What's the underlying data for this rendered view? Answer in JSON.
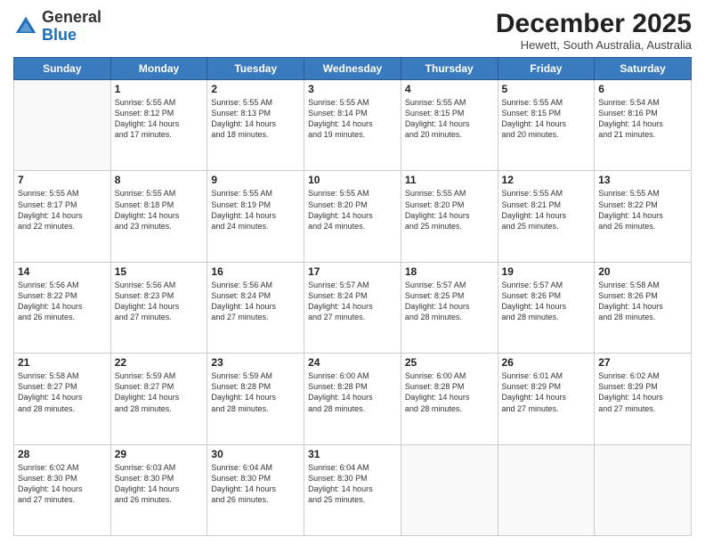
{
  "logo": {
    "general": "General",
    "blue": "Blue"
  },
  "header": {
    "month": "December 2025",
    "location": "Hewett, South Australia, Australia"
  },
  "weekdays": [
    "Sunday",
    "Monday",
    "Tuesday",
    "Wednesday",
    "Thursday",
    "Friday",
    "Saturday"
  ],
  "weeks": [
    [
      {
        "day": "",
        "info": ""
      },
      {
        "day": "1",
        "info": "Sunrise: 5:55 AM\nSunset: 8:12 PM\nDaylight: 14 hours\nand 17 minutes."
      },
      {
        "day": "2",
        "info": "Sunrise: 5:55 AM\nSunset: 8:13 PM\nDaylight: 14 hours\nand 18 minutes."
      },
      {
        "day": "3",
        "info": "Sunrise: 5:55 AM\nSunset: 8:14 PM\nDaylight: 14 hours\nand 19 minutes."
      },
      {
        "day": "4",
        "info": "Sunrise: 5:55 AM\nSunset: 8:15 PM\nDaylight: 14 hours\nand 20 minutes."
      },
      {
        "day": "5",
        "info": "Sunrise: 5:55 AM\nSunset: 8:15 PM\nDaylight: 14 hours\nand 20 minutes."
      },
      {
        "day": "6",
        "info": "Sunrise: 5:54 AM\nSunset: 8:16 PM\nDaylight: 14 hours\nand 21 minutes."
      }
    ],
    [
      {
        "day": "7",
        "info": "Sunrise: 5:55 AM\nSunset: 8:17 PM\nDaylight: 14 hours\nand 22 minutes."
      },
      {
        "day": "8",
        "info": "Sunrise: 5:55 AM\nSunset: 8:18 PM\nDaylight: 14 hours\nand 23 minutes."
      },
      {
        "day": "9",
        "info": "Sunrise: 5:55 AM\nSunset: 8:19 PM\nDaylight: 14 hours\nand 24 minutes."
      },
      {
        "day": "10",
        "info": "Sunrise: 5:55 AM\nSunset: 8:20 PM\nDaylight: 14 hours\nand 24 minutes."
      },
      {
        "day": "11",
        "info": "Sunrise: 5:55 AM\nSunset: 8:20 PM\nDaylight: 14 hours\nand 25 minutes."
      },
      {
        "day": "12",
        "info": "Sunrise: 5:55 AM\nSunset: 8:21 PM\nDaylight: 14 hours\nand 25 minutes."
      },
      {
        "day": "13",
        "info": "Sunrise: 5:55 AM\nSunset: 8:22 PM\nDaylight: 14 hours\nand 26 minutes."
      }
    ],
    [
      {
        "day": "14",
        "info": "Sunrise: 5:56 AM\nSunset: 8:22 PM\nDaylight: 14 hours\nand 26 minutes."
      },
      {
        "day": "15",
        "info": "Sunrise: 5:56 AM\nSunset: 8:23 PM\nDaylight: 14 hours\nand 27 minutes."
      },
      {
        "day": "16",
        "info": "Sunrise: 5:56 AM\nSunset: 8:24 PM\nDaylight: 14 hours\nand 27 minutes."
      },
      {
        "day": "17",
        "info": "Sunrise: 5:57 AM\nSunset: 8:24 PM\nDaylight: 14 hours\nand 27 minutes."
      },
      {
        "day": "18",
        "info": "Sunrise: 5:57 AM\nSunset: 8:25 PM\nDaylight: 14 hours\nand 28 minutes."
      },
      {
        "day": "19",
        "info": "Sunrise: 5:57 AM\nSunset: 8:26 PM\nDaylight: 14 hours\nand 28 minutes."
      },
      {
        "day": "20",
        "info": "Sunrise: 5:58 AM\nSunset: 8:26 PM\nDaylight: 14 hours\nand 28 minutes."
      }
    ],
    [
      {
        "day": "21",
        "info": "Sunrise: 5:58 AM\nSunset: 8:27 PM\nDaylight: 14 hours\nand 28 minutes."
      },
      {
        "day": "22",
        "info": "Sunrise: 5:59 AM\nSunset: 8:27 PM\nDaylight: 14 hours\nand 28 minutes."
      },
      {
        "day": "23",
        "info": "Sunrise: 5:59 AM\nSunset: 8:28 PM\nDaylight: 14 hours\nand 28 minutes."
      },
      {
        "day": "24",
        "info": "Sunrise: 6:00 AM\nSunset: 8:28 PM\nDaylight: 14 hours\nand 28 minutes."
      },
      {
        "day": "25",
        "info": "Sunrise: 6:00 AM\nSunset: 8:28 PM\nDaylight: 14 hours\nand 28 minutes."
      },
      {
        "day": "26",
        "info": "Sunrise: 6:01 AM\nSunset: 8:29 PM\nDaylight: 14 hours\nand 27 minutes."
      },
      {
        "day": "27",
        "info": "Sunrise: 6:02 AM\nSunset: 8:29 PM\nDaylight: 14 hours\nand 27 minutes."
      }
    ],
    [
      {
        "day": "28",
        "info": "Sunrise: 6:02 AM\nSunset: 8:30 PM\nDaylight: 14 hours\nand 27 minutes."
      },
      {
        "day": "29",
        "info": "Sunrise: 6:03 AM\nSunset: 8:30 PM\nDaylight: 14 hours\nand 26 minutes."
      },
      {
        "day": "30",
        "info": "Sunrise: 6:04 AM\nSunset: 8:30 PM\nDaylight: 14 hours\nand 26 minutes."
      },
      {
        "day": "31",
        "info": "Sunrise: 6:04 AM\nSunset: 8:30 PM\nDaylight: 14 hours\nand 25 minutes."
      },
      {
        "day": "",
        "info": ""
      },
      {
        "day": "",
        "info": ""
      },
      {
        "day": "",
        "info": ""
      }
    ]
  ]
}
